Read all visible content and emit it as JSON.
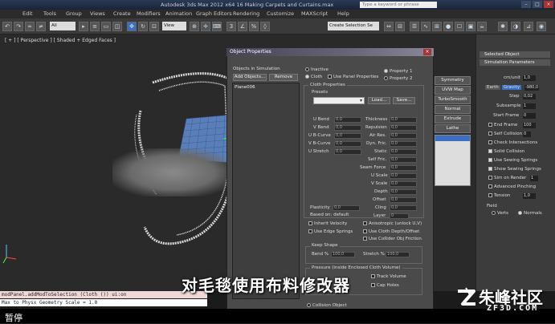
{
  "app": {
    "window_title": "Autodesk 3ds Max 2012 x64     16 Making Carpets and Curtains.max",
    "search_placeholder": "Type a keyword or phrase"
  },
  "menu": [
    "Edit",
    "Tools",
    "Group",
    "Views",
    "Create",
    "Modifiers",
    "Animation",
    "Graph Editors",
    "Rendering",
    "Customize",
    "MAXScript",
    "Help"
  ],
  "toolbar": {
    "filter_value": "All",
    "view_value": "View",
    "selection_set": "Create Selection Se"
  },
  "viewport": {
    "label": "[ + ] [ Perspective ] [ Shaded + Edged Faces ]"
  },
  "command_panel": {
    "selected_object_header": "Selected Object",
    "sim_params_header": "Simulation Parameters",
    "cm_label": "cm/unit",
    "cm_value": "1,0",
    "earth_label": "Earth",
    "gravity_label": "Gravity",
    "gravity_value": "-980,0",
    "step_label": "Step",
    "step_value": "0,02",
    "subsample_label": "Subsample",
    "subsample_value": "1",
    "start_frame_label": "Start Frame",
    "start_frame_value": "0",
    "end_frame_label": "End Frame",
    "end_frame_value": "100",
    "self_collision_label": "Self Collision",
    "self_collision_value": "0",
    "check_intersections": "Check Intersections",
    "solid_collision": "Solid Collision",
    "use_sewing_springs": "Use Sewing Springs",
    "show_sewing_springs": "Show Sewing Springs",
    "sim_on_render": "Sim on Render",
    "sim_on_render_value": "1",
    "advanced_pinching": "Advanced Pinching",
    "tension": "Tension",
    "tension_value": "1,0",
    "field_label": "Field",
    "verts": "Verts",
    "normals": "Normals"
  },
  "side_buttons": [
    "Symmetry",
    "UVW Map",
    "TurboSmooth",
    "Normal",
    "Extrude",
    "Lathe"
  ],
  "dialog": {
    "title": "Object Properties",
    "objects_in_sim": "Objects in Simulation",
    "add_objects": "Add Objects...",
    "remove": "Remove",
    "list_item": "Plane006",
    "inactive": "Inactive",
    "cloth": "Cloth",
    "use_panel_properties": "Use Panel Properties",
    "property1": "Property 1",
    "property2": "Property 2",
    "cloth_properties": "Cloth Properties",
    "presets": "Presets",
    "load": "Load...",
    "save": "Save...",
    "left_fields": [
      {
        "label": "U Bend",
        "value": "0,0"
      },
      {
        "label": "V Bend",
        "value": "0,0"
      },
      {
        "label": "U B-Curve",
        "value": "0,0"
      },
      {
        "label": "V B-Curve",
        "value": "0,0"
      },
      {
        "label": "U Stretch",
        "value": "0,0"
      }
    ],
    "right_fields": [
      {
        "label": "Thickness",
        "value": "0,0"
      },
      {
        "label": "Repulsion",
        "value": "0,0"
      },
      {
        "label": "Air Res.",
        "value": "0,0"
      },
      {
        "label": "Dyn. Fric.",
        "value": "0,0"
      },
      {
        "label": "Static",
        "value": "0,0"
      },
      {
        "label": "Self Fric.",
        "value": "0,0"
      },
      {
        "label": "Seam Force",
        "value": "0,0"
      },
      {
        "label": "U Scale",
        "value": "0,0"
      },
      {
        "label": "V Scale",
        "value": "0,0"
      },
      {
        "label": "Depth",
        "value": "0,0"
      },
      {
        "label": "Offset",
        "value": "0,0"
      },
      {
        "label": "Cling",
        "value": "0,0"
      },
      {
        "label": "Layer",
        "value": "0"
      }
    ],
    "plasticity_label": "Plasticity",
    "plasticity_value": "0,0",
    "based_on": "Based on: default",
    "inherit_velocity": "Inherit Velocity",
    "anisotropic": "Anisotropic (unlock U,V)",
    "use_edge_springs": "Use Edge Springs",
    "use_cloth_depth": "Use Cloth Depth/Offset",
    "use_collider_friction": "Use Collider Obj Friction",
    "keep_shape": "Keep Shape",
    "bend_pct": "Bend %",
    "bend_value": "100,0",
    "stretch_pct": "Stretch %",
    "stretch_value": "100,0",
    "pressure": "Pressure (inside Enclosed Cloth Volume)",
    "track_volume": "Track Volume",
    "cap_holes": "Cap Holes",
    "collision_object": "Collision Object"
  },
  "listener": {
    "line1": "modPanel.addModToSelection (Cloth ()) ui:on",
    "line2": "Max to Physx Geometry Scale = 1.0"
  },
  "status_text": "暂停",
  "subtitle": "对毛毯使用布料修改器",
  "logo": {
    "big": "朱峰社区",
    "small": "ZF3D.COM"
  },
  "colors": {
    "accent": "#3b6fc4",
    "subtitle": "#ffffff",
    "carpet": "#5a7fb8"
  }
}
